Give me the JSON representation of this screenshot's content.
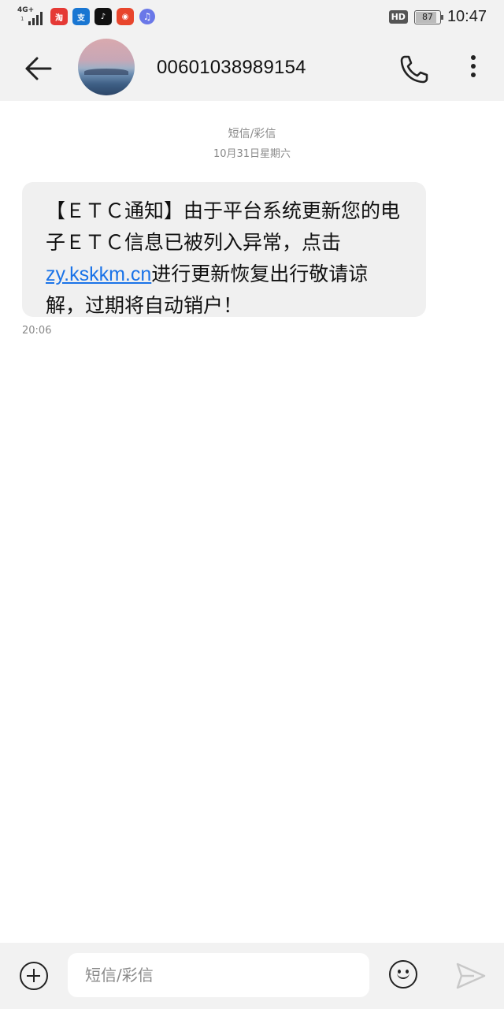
{
  "status_bar": {
    "network": "4G+",
    "hd_label": "HD",
    "battery": "87",
    "time": "10:47",
    "app_icons": [
      "taobao-icon",
      "alipay-icon",
      "tiktok-icon",
      "weibo-icon",
      "music-icon"
    ]
  },
  "header": {
    "contact_number": "00601038989154"
  },
  "conversation": {
    "message_type": "短信/彩信",
    "date": "10月31日星期六",
    "message": {
      "text_before_link": "【ＥＴＣ通知】由于平台系统更新您的电子ＥＴＣ信息已被列入异常，点击",
      "link_text": "zy.kskkm.cn",
      "text_after_link": "进行更新恢复出行敬请谅解，过期将自动销户！",
      "time": "20:06"
    }
  },
  "input_bar": {
    "placeholder": "短信/彩信"
  },
  "colors": {
    "link": "#1a73e8",
    "bubble_bg": "#f0f0f0",
    "bar_bg": "#f2f2f2"
  }
}
